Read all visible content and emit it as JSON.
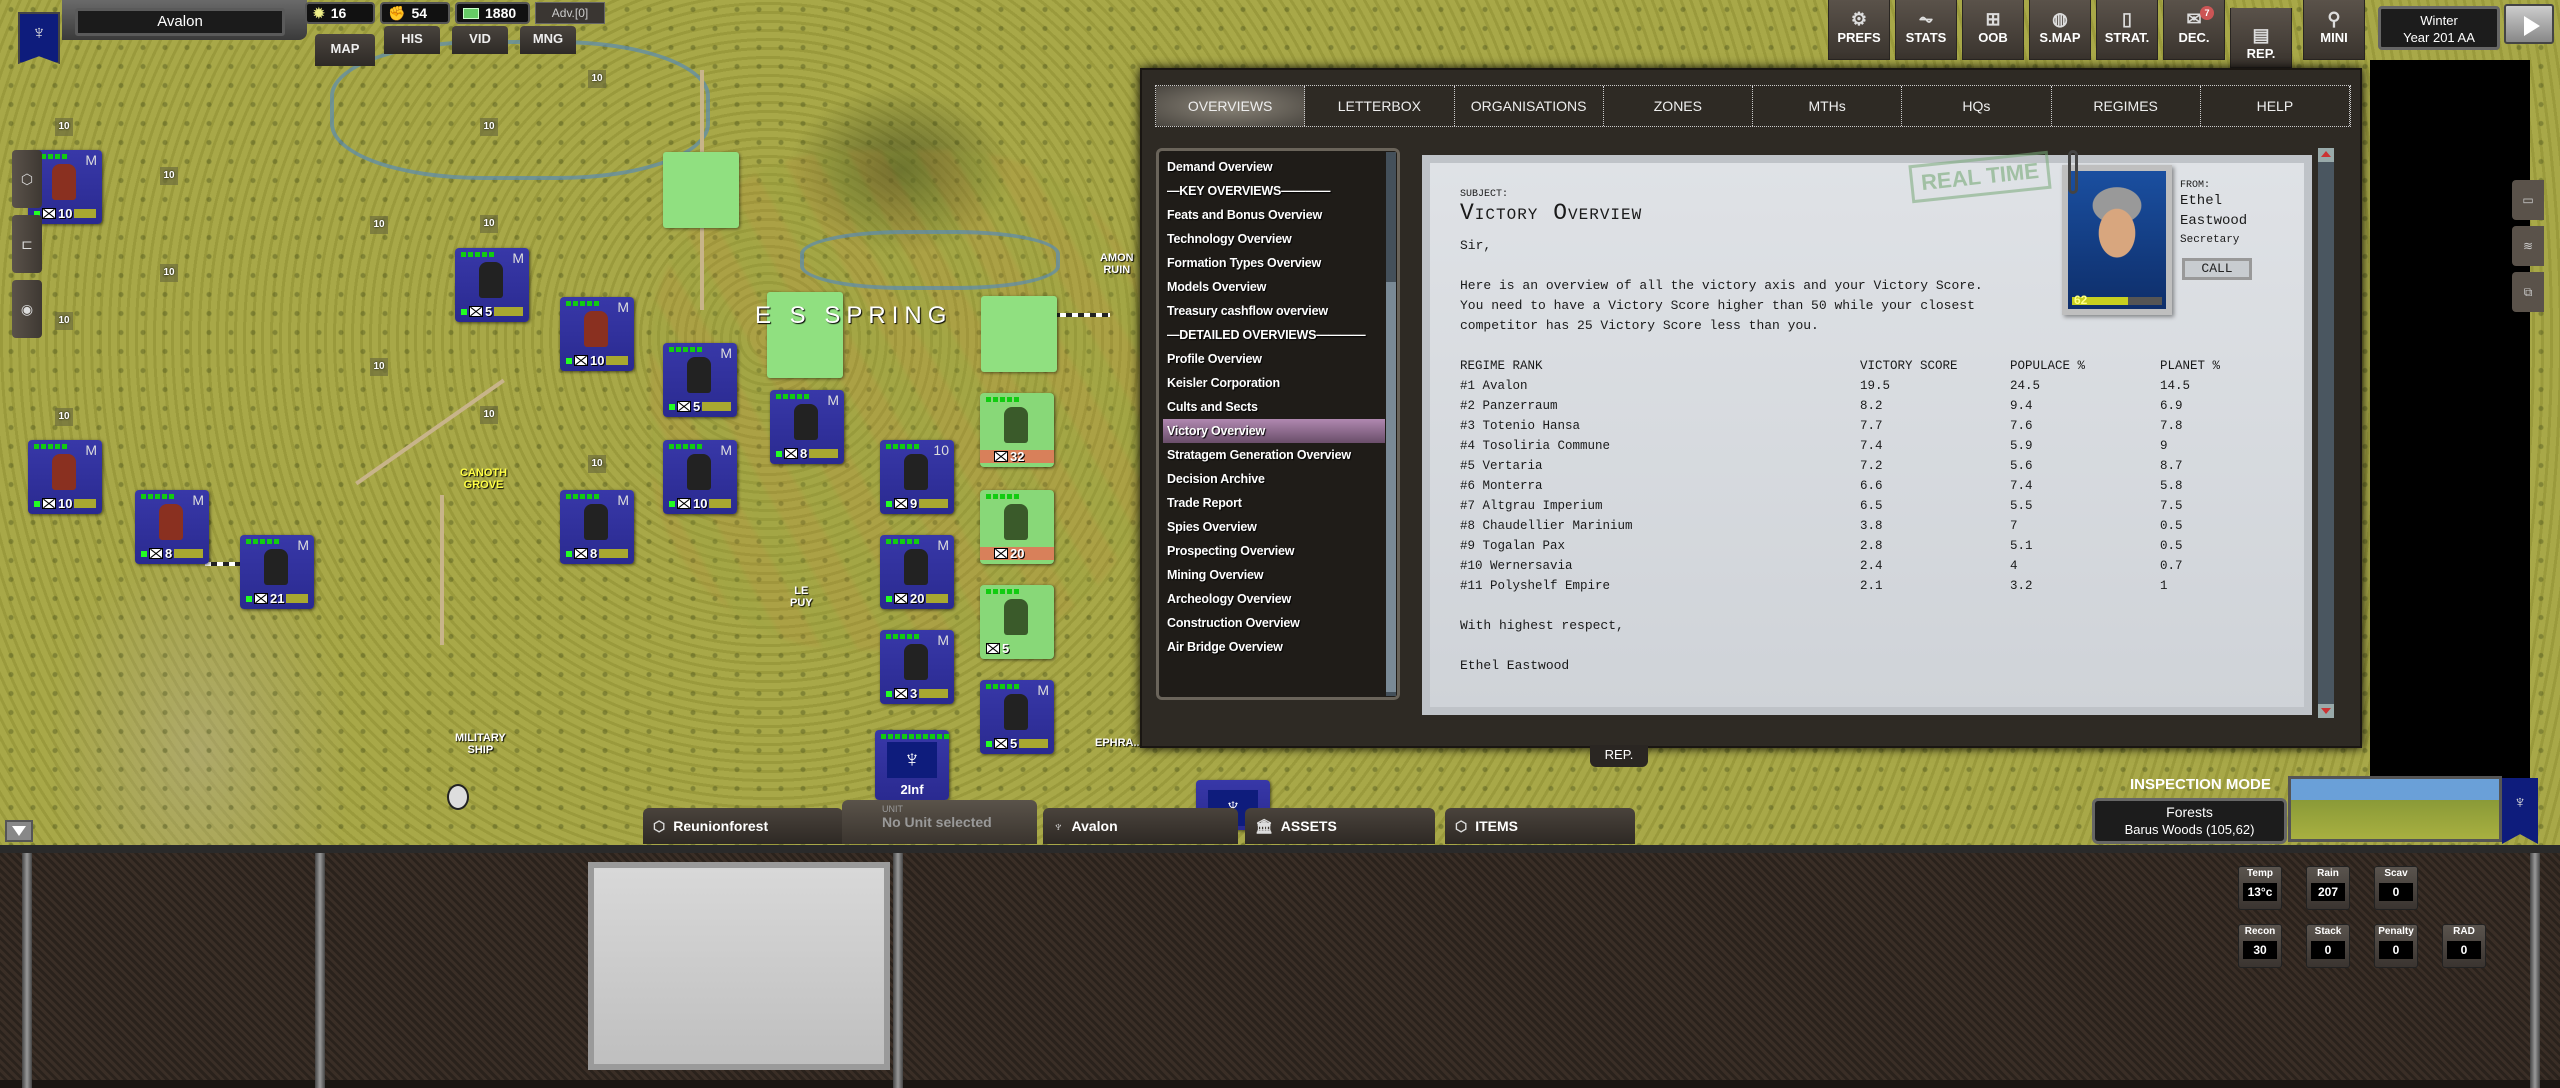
{
  "topbar": {
    "regime_name": "Avalon",
    "resources": [
      {
        "icon": "sun-icon",
        "value": "16"
      },
      {
        "icon": "fist-icon",
        "value": "54"
      },
      {
        "icon": "cash-icon",
        "value": "1880"
      }
    ],
    "advisor": "Adv.[0]",
    "nav_tabs": [
      "MAP",
      "HIS",
      "VID",
      "MNG"
    ],
    "buttons": [
      {
        "label": "PREFS",
        "icon": "gear-icon",
        "glyph": "⚙"
      },
      {
        "label": "STATS",
        "icon": "chart-icon",
        "glyph": "📈"
      },
      {
        "label": "OOB",
        "icon": "hierarchy-icon",
        "glyph": "⊞"
      },
      {
        "label": "S.MAP",
        "icon": "globe-icon",
        "glyph": "◍"
      },
      {
        "label": "STRAT.",
        "icon": "cards-icon",
        "glyph": "▯"
      },
      {
        "label": "DEC.",
        "icon": "envelope-icon",
        "glyph": "✉",
        "badge": "7"
      },
      {
        "label": "REP.",
        "icon": "report-icon",
        "glyph": "▤"
      },
      {
        "label": "MINI",
        "icon": "location-pin-icon",
        "glyph": "⚲"
      }
    ],
    "season": "Winter",
    "year": "Year 201 AA"
  },
  "overview": {
    "tabs": [
      "OVERVIEWS",
      "LETTERBOX",
      "ORGANISATIONS",
      "ZONES",
      "MTHs",
      "HQs",
      "REGIMES",
      "HELP"
    ],
    "active_tab": "OVERVIEWS",
    "list": [
      "Demand Overview",
      "—KEY OVERVIEWS————",
      "Feats and Bonus Overview",
      "Technology Overview",
      "Formation Types Overview",
      "Models Overview",
      "Treasury cashflow overview",
      "—DETAILED OVERVIEWS————",
      "Profile Overview",
      "Keisler Corporation",
      "Cults and Sects",
      "Victory Overview",
      "Stratagem Generation Overview",
      "Decision Archive",
      "Trade Report",
      "Spies Overview",
      "Prospecting Overview",
      "Mining Overview",
      "Archeology Overview",
      "Construction Overview",
      "Air Bridge Overview"
    ],
    "selected": "Victory Overview",
    "rep_button": "REP."
  },
  "letter": {
    "subject_label": "SUBJECT:",
    "title": "Victory Overview",
    "stamp": "REAL TIME",
    "greeting": "Sir,",
    "body_1": "Here is an overview of all the victory axis and your Victory Score.",
    "body_2": "You need to have a Victory Score higher than 50 while your closest",
    "body_3": "competitor has 25 Victory Score less than you.",
    "table_headers": [
      "REGIME RANK",
      "VICTORY SCORE",
      "POPULACE %",
      "PLANET %"
    ],
    "rows": [
      [
        "#1 Avalon",
        "19.5",
        "24.5",
        "14.5"
      ],
      [
        "#2 Panzerraum",
        "8.2",
        "9.4",
        "6.9"
      ],
      [
        "#3 Totenio Hansa",
        "7.7",
        "7.6",
        "7.8"
      ],
      [
        "#4 Tosoliria Commune",
        "7.4",
        "5.9",
        "9"
      ],
      [
        "#5 Vertaria",
        "7.2",
        "5.6",
        "8.7"
      ],
      [
        "#6 Monterra",
        "6.6",
        "7.4",
        "5.8"
      ],
      [
        "#7 Altgrau Imperium",
        "6.5",
        "5.5",
        "7.5"
      ],
      [
        "#8 Chaudellier Marinium",
        "3.8",
        "7",
        "0.5"
      ],
      [
        "#9 Togalan Pax",
        "2.8",
        "5.1",
        "0.5"
      ],
      [
        "#10 Wernersavia",
        "2.4",
        "4",
        "0.7"
      ],
      [
        "#11 Polyshelf Empire",
        "2.1",
        "3.2",
        "1"
      ]
    ],
    "closing": "With highest respect,",
    "signature": "Ethel Eastwood",
    "from_label": "FROM:",
    "from_first": "Ethel",
    "from_last": "Eastwood",
    "from_role": "Secretary",
    "call_button": "CALL",
    "portrait_level": "62",
    "portrait_level_fraction": 0.62
  },
  "map": {
    "labels": {
      "city_spring": "E   S SPRING",
      "canoth": "CANOTH\nGROVE",
      "lepuy": "LE\nPUY",
      "military": "MILITARY\nSHIP",
      "amon": "AMON\nRUIN",
      "ephra": "EPHRA..."
    },
    "hex_value": "10",
    "units": [
      {
        "num": "10",
        "kind": "alien",
        "m": "M"
      },
      {
        "num": "5",
        "kind": "infantry",
        "m": "M"
      },
      {
        "num": "10",
        "kind": "alien",
        "m": "M"
      },
      {
        "num": "5",
        "kind": "infantry",
        "m": "M"
      },
      {
        "num": "8",
        "kind": "infantry",
        "m": "M"
      },
      {
        "num": "10",
        "kind": "infantry",
        "m": "M"
      },
      {
        "num": "10",
        "kind": "alien",
        "m": "M"
      },
      {
        "num": "8",
        "kind": "beast",
        "m": "M"
      },
      {
        "num": "21",
        "kind": "infantry",
        "m": "M"
      },
      {
        "num": "8",
        "kind": "infantry",
        "m": "M"
      },
      {
        "num": "9",
        "kind": "armored",
        "m": "10"
      },
      {
        "num": "20",
        "kind": "infantry",
        "m": "M"
      },
      {
        "num": "3",
        "kind": "infantry",
        "m": "M"
      },
      {
        "num": "5",
        "kind": "infantry",
        "m": "M"
      },
      {
        "num": "32",
        "kind": "enemy",
        "m": ""
      },
      {
        "num": "20",
        "kind": "enemy",
        "m": ""
      },
      {
        "num": "5",
        "kind": "truck",
        "m": ""
      }
    ],
    "hq_unit": "2Inf"
  },
  "bottom_tabs": {
    "location": "Reunionforest",
    "unit_label": "UNIT",
    "unit_value": "No Unit selected",
    "regime": "Avalon",
    "assets": "ASSETS",
    "items": "ITEMS"
  },
  "inspection": {
    "mode": "INSPECTION MODE",
    "terrain": "Forests",
    "location": "Barus Woods (105,62)"
  },
  "stats": [
    {
      "label": "Temp",
      "value": "13°c"
    },
    {
      "label": "Rain",
      "value": "207"
    },
    {
      "label": "Scav",
      "value": "0"
    },
    {
      "label": "Recon",
      "value": "30"
    },
    {
      "label": "Stack",
      "value": "0"
    },
    {
      "label": "Penalty",
      "value": "0"
    },
    {
      "label": "RAD",
      "value": "0"
    }
  ],
  "colors": {
    "regime_blue": "#2a2a90",
    "enemy_green": "#88d878",
    "selected_item": "#9a6e9a"
  }
}
